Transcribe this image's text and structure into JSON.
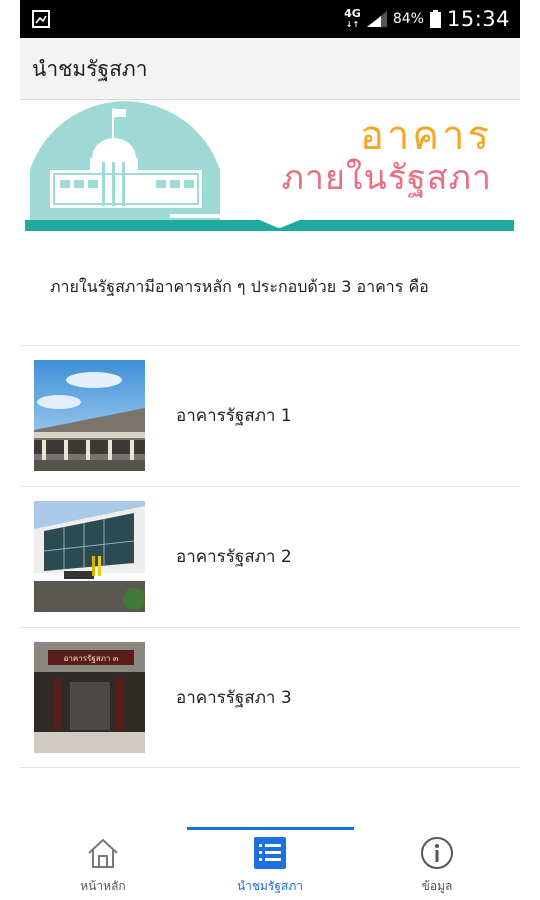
{
  "status_bar": {
    "network": "4G",
    "battery": "84%",
    "time": "15:34",
    "icons": [
      "image-icon",
      "signal-icon",
      "battery-icon"
    ]
  },
  "app_bar": {
    "title": "นำชมรัฐสภา"
  },
  "banner": {
    "line1": "อาคาร",
    "line2": "ภายในรัฐสภา",
    "colors": {
      "teal": "#9ed9d5",
      "stripe": "#1fa9a0",
      "orange": "#f5a623",
      "pink": "#ec6d80"
    }
  },
  "intro": "ภายในรัฐสภามีอาคารหลัก ๆ ประกอบด้วย 3 อาคาร คือ",
  "buildings": [
    {
      "label": "อาคารรัฐสภา 1"
    },
    {
      "label": "อาคารรัฐสภา 2"
    },
    {
      "label": "อาคารรัฐสภา 3",
      "sign": "อาคารรัฐสภา ๓"
    }
  ],
  "bottom_nav": {
    "items": [
      {
        "label": "หน้าหลัก",
        "icon": "home-icon"
      },
      {
        "label": "นำชมรัฐสภา",
        "icon": "list-icon",
        "active": true
      },
      {
        "label": "ข้อมูล",
        "icon": "info-icon"
      }
    ],
    "accent": "#1e6fe0"
  }
}
